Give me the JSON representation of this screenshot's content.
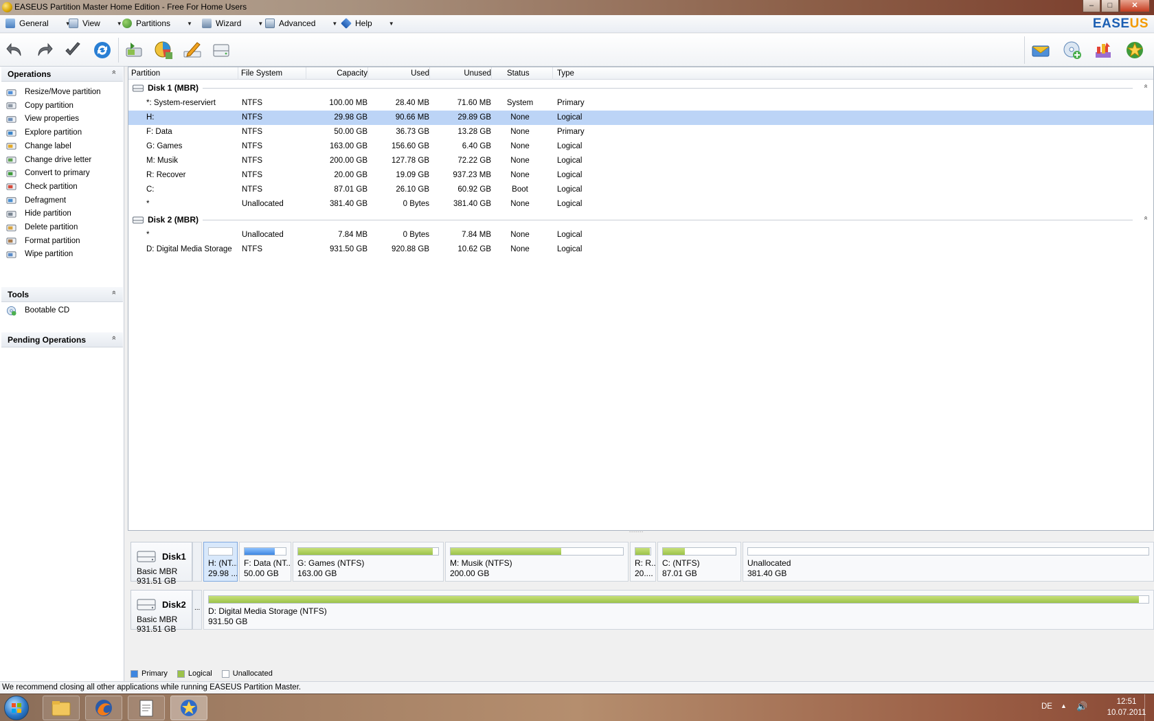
{
  "window": {
    "title": "EASEUS Partition Master Home Edition - Free For Home Users",
    "minimize": "‒",
    "maximize": "□",
    "close": "✕"
  },
  "menu": {
    "items": [
      {
        "label": "General",
        "icon": "general-icon"
      },
      {
        "label": "View",
        "icon": "view-icon"
      },
      {
        "label": "Partitions",
        "icon": "partitions-icon"
      },
      {
        "label": "Wizard",
        "icon": "wizard-icon"
      },
      {
        "label": "Advanced",
        "icon": "advanced-icon"
      },
      {
        "label": "Help",
        "icon": "help-icon"
      }
    ],
    "brand_main": "EASE",
    "brand_accent": "US"
  },
  "toolbar": {
    "left_buttons": [
      "undo-icon",
      "redo-icon",
      "apply-icon",
      "refresh-icon",
      "resize-icon",
      "properties-icon",
      "label-icon",
      "disk-icon"
    ],
    "right_buttons": [
      "mail-icon",
      "bootable-cd-icon",
      "upgrade-icon",
      "star-icon"
    ]
  },
  "sidebar": {
    "operations_title": "Operations",
    "operations": [
      {
        "label": "Resize/Move partition",
        "icon": "resize-icon"
      },
      {
        "label": "Copy partition",
        "icon": "copy-icon"
      },
      {
        "label": "View properties",
        "icon": "properties-icon"
      },
      {
        "label": "Explore partition",
        "icon": "explore-icon"
      },
      {
        "label": "Change label",
        "icon": "label-icon"
      },
      {
        "label": "Change drive letter",
        "icon": "drive-letter-icon"
      },
      {
        "label": "Convert to primary",
        "icon": "convert-icon"
      },
      {
        "label": "Check partition",
        "icon": "check-icon"
      },
      {
        "label": "Defragment",
        "icon": "defragment-icon"
      },
      {
        "label": "Hide partition",
        "icon": "hide-icon"
      },
      {
        "label": "Delete partition",
        "icon": "delete-icon"
      },
      {
        "label": "Format partition",
        "icon": "format-icon"
      },
      {
        "label": "Wipe partition",
        "icon": "wipe-icon"
      }
    ],
    "tools_title": "Tools",
    "tools": [
      {
        "label": "Bootable CD",
        "icon": "bootable-cd-icon"
      }
    ],
    "pending_title": "Pending Operations",
    "collapse": "»"
  },
  "table": {
    "columns": [
      "Partition",
      "File System",
      "Capacity",
      "Used",
      "Unused",
      "Status",
      "Type"
    ],
    "disks": [
      {
        "name": "Disk 1 (MBR)",
        "rows": [
          [
            "*: System-reserviert",
            "NTFS",
            "100.00 MB",
            "28.40 MB",
            "71.60 MB",
            "System",
            "Primary"
          ],
          [
            "H:",
            "NTFS",
            "29.98 GB",
            "90.66 MB",
            "29.89 GB",
            "None",
            "Logical"
          ],
          [
            "F: Data",
            "NTFS",
            "50.00 GB",
            "36.73 GB",
            "13.28 GB",
            "None",
            "Primary"
          ],
          [
            "G: Games",
            "NTFS",
            "163.00 GB",
            "156.60 GB",
            "6.40 GB",
            "None",
            "Logical"
          ],
          [
            "M: Musik",
            "NTFS",
            "200.00 GB",
            "127.78 GB",
            "72.22 GB",
            "None",
            "Logical"
          ],
          [
            "R: Recover",
            "NTFS",
            "20.00 GB",
            "19.09 GB",
            "937.23 MB",
            "None",
            "Logical"
          ],
          [
            "C:",
            "NTFS",
            "87.01 GB",
            "26.10 GB",
            "60.92 GB",
            "Boot",
            "Logical"
          ],
          [
            "*",
            "Unallocated",
            "381.40 GB",
            "0 Bytes",
            "381.40 GB",
            "None",
            "Logical"
          ]
        ]
      },
      {
        "name": "Disk 2 (MBR)",
        "rows": [
          [
            "*",
            "Unallocated",
            "7.84 MB",
            "0 Bytes",
            "7.84 MB",
            "None",
            "Logical"
          ],
          [
            "D: Digital Media Storage",
            "NTFS",
            "931.50 GB",
            "920.88 GB",
            "10.62 GB",
            "None",
            "Logical"
          ]
        ]
      }
    ],
    "collapse": "»"
  },
  "diskmap": {
    "disks": [
      {
        "name": "Disk1",
        "type": "Basic MBR",
        "size": "931.51 GB",
        "partitions": [
          {
            "l1": "H: (NT...",
            "l2": "29.98 ...",
            "used_fraction": 0.003,
            "kind": "logical",
            "selected": true
          },
          {
            "l1": "F: Data (NT...",
            "l2": "50.00 GB",
            "used_fraction": 0.73,
            "kind": "primary",
            "selected": false
          },
          {
            "l1": "G: Games (NTFS)",
            "l2": "163.00 GB",
            "used_fraction": 0.96,
            "kind": "logical",
            "selected": false
          },
          {
            "l1": "M: Musik (NTFS)",
            "l2": "200.00 GB",
            "used_fraction": 0.64,
            "kind": "logical",
            "selected": false
          },
          {
            "l1": "R: R...",
            "l2": "20....",
            "used_fraction": 0.95,
            "kind": "logical",
            "selected": false
          },
          {
            "l1": "C: (NTFS)",
            "l2": "87.01 GB",
            "used_fraction": 0.3,
            "kind": "logical",
            "selected": false
          },
          {
            "l1": "Unallocated",
            "l2": "381.40 GB",
            "used_fraction": 0,
            "kind": "logical",
            "selected": false
          }
        ]
      },
      {
        "name": "Disk2",
        "type": "Basic MBR",
        "size": "931.51 GB",
        "gap_label": "...",
        "partitions": [
          {
            "l1": "D: Digital Media Storage (NTFS)",
            "l2": "931.50 GB",
            "used_fraction": 0.99,
            "kind": "logical",
            "selected": false
          }
        ]
      }
    ],
    "splitter": "˙˙˙˙˙˙˙"
  },
  "legend": {
    "primary": "Primary",
    "logical": "Logical",
    "unallocated": "Unallocated",
    "colors": {
      "primary": "#3d86e0",
      "logical": "#9cc24a",
      "unallocated": "#ffffff"
    }
  },
  "status": {
    "message": "We recommend closing all other applications while running EASEUS Partition Master."
  },
  "taskbar": {
    "apps": [
      "explorer-icon",
      "firefox-icon",
      "notepad-icon",
      "easeus-icon"
    ],
    "lang": "DE",
    "time": "12:51",
    "date": "10.07.2011"
  }
}
